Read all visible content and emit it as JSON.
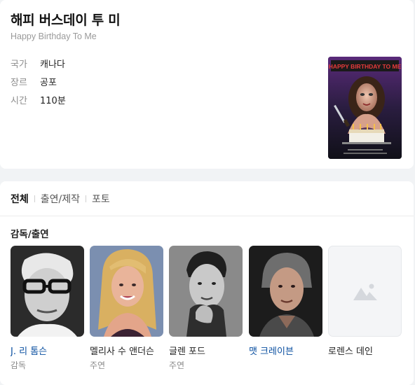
{
  "movie": {
    "title": "해피 버스데이 투 미",
    "original_title": "Happy Birthday To Me",
    "poster_text": "HAPPY BIRTHDAY TO ME"
  },
  "info": [
    {
      "key": "국가",
      "value": "캐나다"
    },
    {
      "key": "장르",
      "value": "공포"
    },
    {
      "key": "시간",
      "value": "110분"
    }
  ],
  "tabs": [
    {
      "label": "전체",
      "active": true
    },
    {
      "label": "출연/제작",
      "active": false
    },
    {
      "label": "포토",
      "active": false
    }
  ],
  "cast_section": {
    "heading": "감독/출연",
    "people": [
      {
        "name": "J. 리 톰슨",
        "role": "감독",
        "linked": true
      },
      {
        "name": "멜리사 수 앤더슨",
        "role": "주연",
        "linked": false
      },
      {
        "name": "글렌 포드",
        "role": "주연",
        "linked": false
      },
      {
        "name": "맷 크레이븐",
        "role": "",
        "linked": true
      },
      {
        "name": "로렌스 데인",
        "role": "",
        "linked": false
      }
    ]
  },
  "colors": {
    "link": "#0a4fa0",
    "muted": "#8d8d8d",
    "page_bg": "#f1f3f5"
  }
}
